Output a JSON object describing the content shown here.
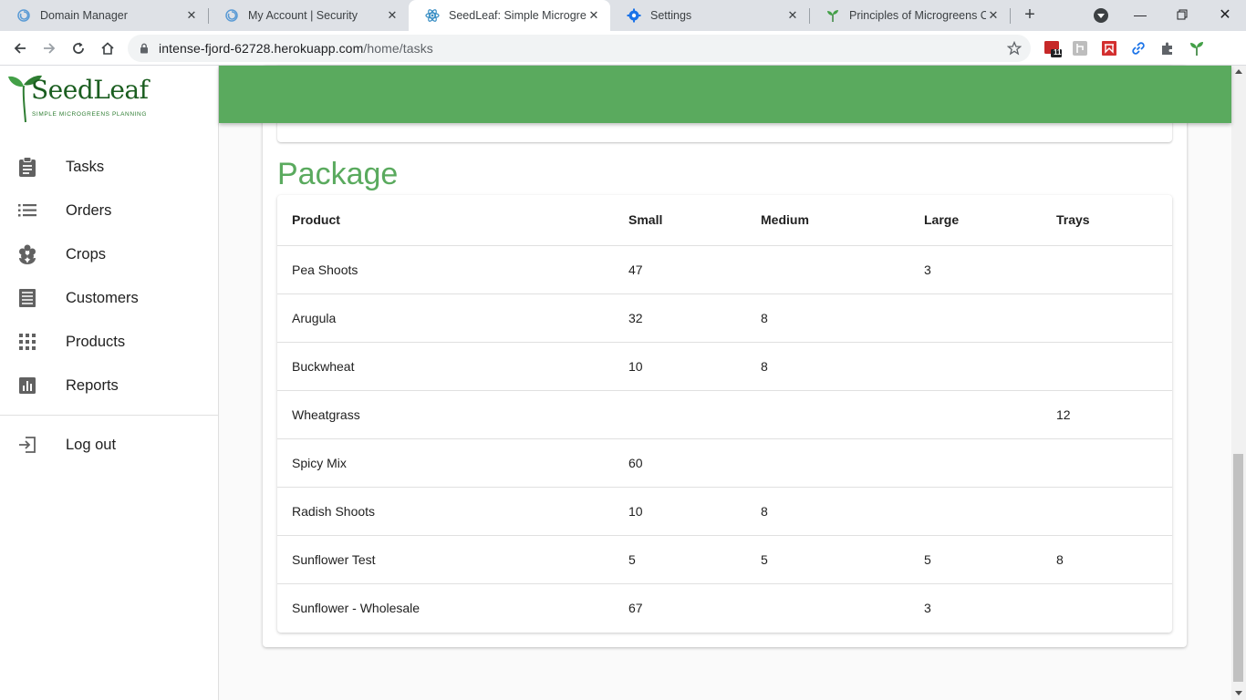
{
  "browser": {
    "tabs": [
      {
        "title": "Domain Manager",
        "icon": "spiral-icon"
      },
      {
        "title": "My Account | Security",
        "icon": "spiral-icon"
      },
      {
        "title": "SeedLeaf: Simple Microgreen",
        "icon": "react-atom-icon"
      },
      {
        "title": "Settings",
        "icon": "gear-icon"
      },
      {
        "title": "Principles of Microgreens Cro",
        "icon": "sprout-icon"
      }
    ],
    "url_host": "intense-fjord-62728.herokuapp.com",
    "url_path": "/home/tasks",
    "calendar_badge": "11"
  },
  "app": {
    "logo_name": "SeedLeaf",
    "logo_tagline": "SIMPLE MICROGREENS PLANNING",
    "nav": [
      {
        "label": "Tasks",
        "icon": "clipboard-icon"
      },
      {
        "label": "Orders",
        "icon": "list-icon"
      },
      {
        "label": "Crops",
        "icon": "flower-icon"
      },
      {
        "label": "Customers",
        "icon": "document-icon"
      },
      {
        "label": "Products",
        "icon": "grid-icon"
      },
      {
        "label": "Reports",
        "icon": "bar-chart-icon"
      }
    ],
    "logout_label": "Log out",
    "accent_color": "#5aaa5e"
  },
  "package": {
    "title": "Package",
    "headers": [
      "Product",
      "Small",
      "Medium",
      "Large",
      "Trays"
    ],
    "rows": [
      [
        "Pea Shoots",
        "47",
        "",
        "3",
        ""
      ],
      [
        "Arugula",
        "32",
        "8",
        "",
        ""
      ],
      [
        "Buckwheat",
        "10",
        "8",
        "",
        ""
      ],
      [
        "Wheatgrass",
        "",
        "",
        "",
        "12"
      ],
      [
        "Spicy Mix",
        "60",
        "",
        "",
        ""
      ],
      [
        "Radish Shoots",
        "10",
        "8",
        "",
        ""
      ],
      [
        "Sunflower Test",
        "5",
        "5",
        "5",
        "8"
      ],
      [
        "Sunflower - Wholesale",
        "67",
        "",
        "3",
        ""
      ]
    ]
  }
}
